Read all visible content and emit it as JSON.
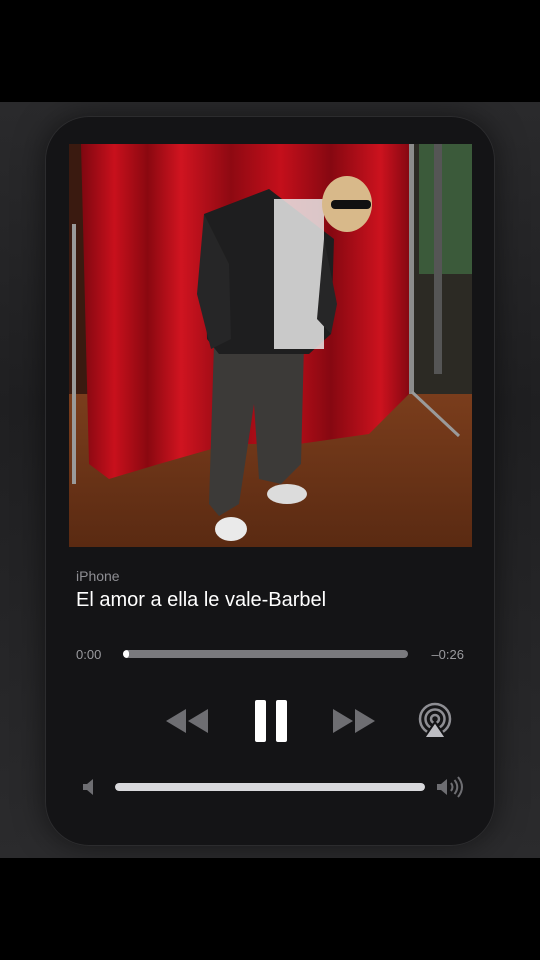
{
  "player": {
    "source": "iPhone",
    "title": "El amor a ella le vale-Barbel",
    "elapsed": "0:00",
    "remaining": "–0:26",
    "progress_fraction": 0.02,
    "volume_fraction": 1.0
  },
  "controls": {
    "rewind_icon": "backward-icon",
    "pause_icon": "pause-icon",
    "forward_icon": "forward-icon",
    "airplay_icon": "airplay-icon",
    "volume_low_icon": "speaker-low-icon",
    "volume_high_icon": "speaker-high-icon"
  },
  "colors": {
    "card_bg": "#141416",
    "accent": "#ffffff",
    "muted_text": "#8e8e93",
    "curtain": "#b10d18"
  }
}
